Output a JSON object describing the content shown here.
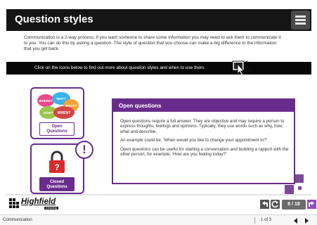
{
  "header": {
    "title": "Question styles",
    "menu_icon": "hamburger-menu-icon"
  },
  "intro": {
    "text": "Communication is a 2-way process; if you want someone to share some information you may need to ask them to communicate it to you. You can do this by asking a question. The style of question that you choose can make a big difference to the information that you get back."
  },
  "instruction": {
    "text": "Click on the icons below to find out more about question styles and when to use them.",
    "icon": "click-pointer-icon"
  },
  "cards": {
    "open": {
      "label_line1": "Open",
      "label_line2": "Questions",
      "bubble_words": [
        "WHERE?",
        "WHY?",
        "WHAT?",
        "HOW?",
        "WHEN?"
      ],
      "icon": "speech-bubbles-icon"
    },
    "closed": {
      "label_line1": "Closed",
      "label_line2": "Questions",
      "icon": "padlock-icon"
    },
    "alert_icon": "exclamation-icon",
    "alert_symbol": "!"
  },
  "panel": {
    "title": "Open questions",
    "paragraphs": [
      "Open questions require a full answer. They are objective and may require a person to express thoughts, feelings and opinions. Typically, they use words such as why, how, what and describe.",
      "An example could be, 'When would you like to change your appointment to?'",
      "Open questions can be useful for starting a conversation and building a rapport with the other person, for example, 'How are you feeling today?'"
    ]
  },
  "branding": {
    "logo_name": "Highfield",
    "logo_tagline": "e-learning"
  },
  "navigation": {
    "page_counter": "6 / 18",
    "back_icon": "back-arrow-icon",
    "refresh_icon": "refresh-icon",
    "next_icon": "next-arrow-icon"
  },
  "status_bar": {
    "section": "Communication",
    "pages": "1 of 3"
  },
  "colors": {
    "accent_purple": "#6a2c8c",
    "title_bar": "#151515",
    "instruction_bar": "#070707"
  }
}
